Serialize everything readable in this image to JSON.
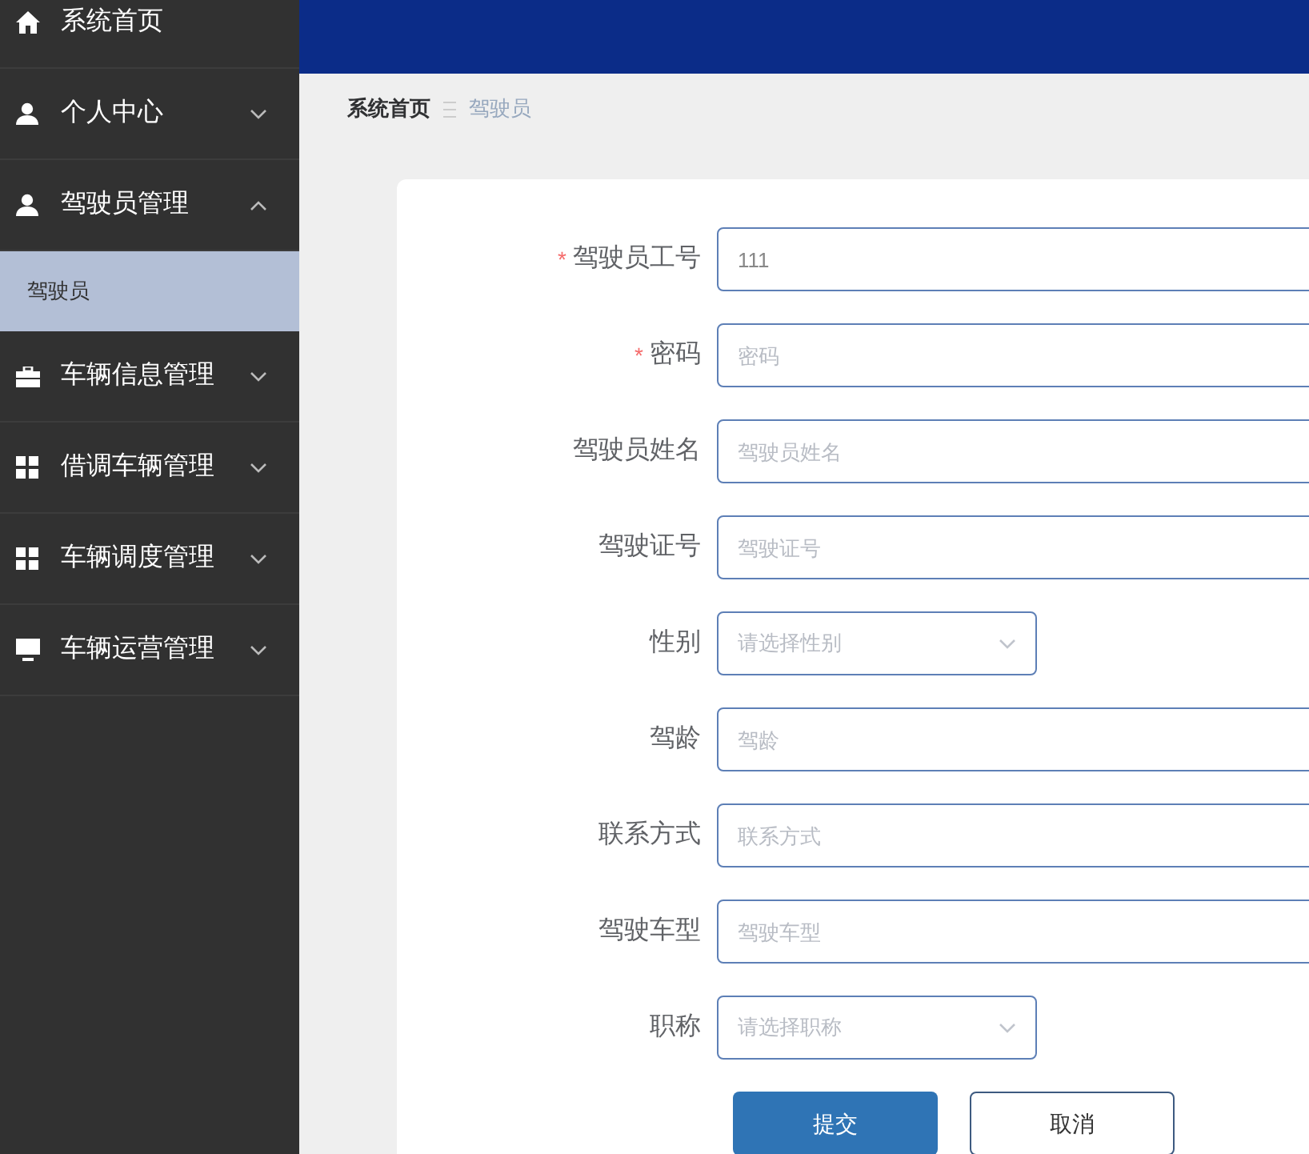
{
  "sidebar": {
    "items": [
      {
        "label": "系统首页"
      },
      {
        "label": "个人中心",
        "expanded": false
      },
      {
        "label": "驾驶员管理",
        "expanded": true,
        "children": [
          {
            "label": "驾驶员",
            "selected": true
          }
        ]
      },
      {
        "label": "车辆信息管理",
        "expanded": false
      },
      {
        "label": "借调车辆管理",
        "expanded": false
      },
      {
        "label": "车辆调度管理",
        "expanded": false
      },
      {
        "label": "车辆运营管理",
        "expanded": false
      }
    ]
  },
  "breadcrumb": [
    "系统首页",
    "驾驶员"
  ],
  "form": {
    "fields": [
      {
        "label": "驾驶员工号",
        "kind": "input",
        "required_mark": "*",
        "value": "111"
      },
      {
        "label": "密码",
        "kind": "input",
        "required_mark": "*",
        "placeholder": "密码"
      },
      {
        "label": "驾驶员姓名",
        "kind": "input",
        "placeholder": "驾驶员姓名"
      },
      {
        "label": "驾驶证号",
        "kind": "input",
        "placeholder": "驾驶证号"
      },
      {
        "label": "性别",
        "kind": "select",
        "placeholder": "请选择性别"
      },
      {
        "label": "驾龄",
        "kind": "input",
        "placeholder": "驾龄"
      },
      {
        "label": "联系方式",
        "kind": "input",
        "placeholder": "联系方式"
      },
      {
        "label": "驾驶车型",
        "kind": "input",
        "placeholder": "驾驶车型"
      },
      {
        "label": "职称",
        "kind": "select",
        "placeholder": "请选择职称"
      }
    ],
    "buttons": [
      {
        "label": "提交",
        "kind": "primary"
      },
      {
        "label": "取消",
        "kind": "secondary"
      }
    ]
  }
}
